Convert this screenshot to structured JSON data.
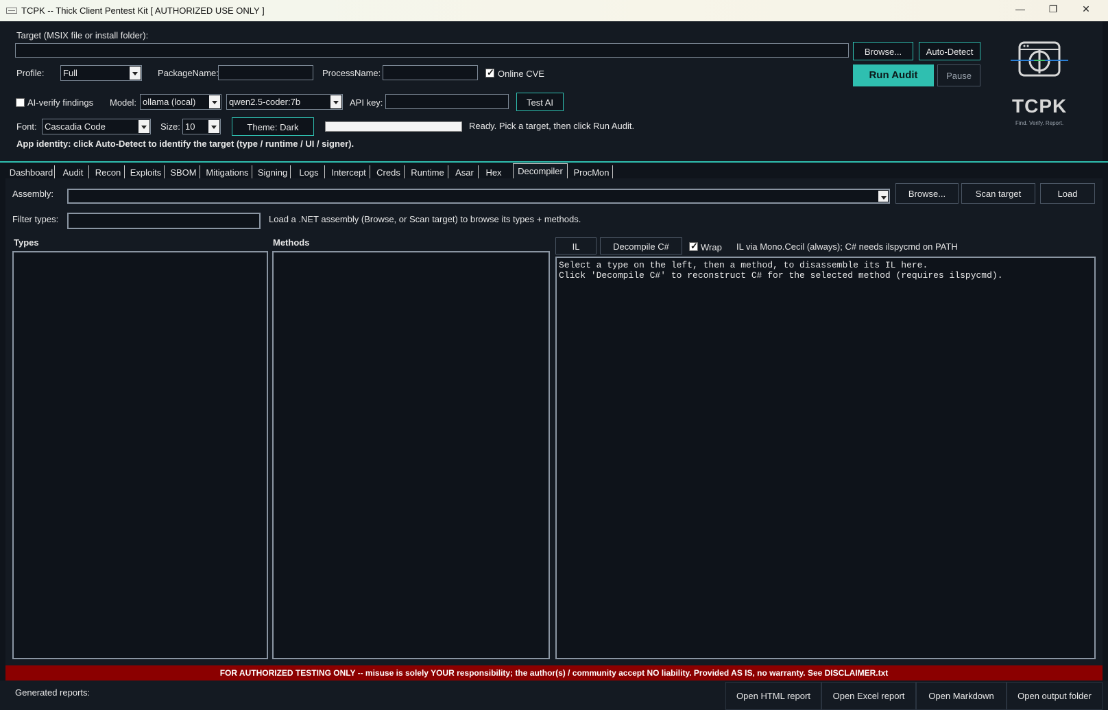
{
  "window": {
    "title": "TCPK -- Thick Client Pentest Kit   [ AUTHORIZED USE ONLY ]",
    "minimize": "—",
    "maximize": "❐",
    "close": "✕"
  },
  "top": {
    "target_label": "Target (MSIX file or install folder):",
    "target_value": "",
    "browse": "Browse...",
    "auto_detect": "Auto-Detect",
    "profile_label": "Profile:",
    "profile_value": "Full",
    "package_label": "PackageName:",
    "package_value": "",
    "process_label": "ProcessName:",
    "process_value": "",
    "online_cve_label": "Online CVE",
    "online_cve_checked": true,
    "run_audit": "Run Audit",
    "pause": "Pause",
    "ai_verify_label": "AI-verify findings",
    "ai_verify_checked": false,
    "model_label": "Model:",
    "model_value": "ollama (local)",
    "model_name_value": "qwen2.5-coder:7b",
    "api_key_label": "API key:",
    "api_key_value": "",
    "test_ai": "Test AI",
    "font_label": "Font:",
    "font_value": "Cascadia Code",
    "size_label": "Size:",
    "size_value": "10",
    "theme_button": "Theme: Dark",
    "status": "Ready. Pick a target, then click Run Audit.",
    "progress": 0,
    "identity": "App identity: click Auto-Detect to identify the target (type / runtime / UI / signer)."
  },
  "logo": {
    "name": "TCPK",
    "tagline": "Find. Verify. Report."
  },
  "tabs": [
    {
      "label": "Dashboard"
    },
    {
      "label": "Audit"
    },
    {
      "label": "Recon"
    },
    {
      "label": "Exploits"
    },
    {
      "label": "SBOM"
    },
    {
      "label": "Mitigations"
    },
    {
      "label": "Signing"
    },
    {
      "label": "Logs"
    },
    {
      "label": "Intercept"
    },
    {
      "label": "Creds"
    },
    {
      "label": "Runtime"
    },
    {
      "label": "Asar"
    },
    {
      "label": "Hex"
    },
    {
      "label": "Decompiler"
    },
    {
      "label": "ProcMon"
    }
  ],
  "active_tab": "Decompiler",
  "decompiler": {
    "assembly_label": "Assembly:",
    "assembly_value": "",
    "browse": "Browse...",
    "scan_target": "Scan target",
    "load": "Load",
    "filter_label": "Filter types:",
    "filter_value": "",
    "hint": "Load a .NET assembly (Browse, or Scan target) to browse its types + methods.",
    "types_header": "Types",
    "methods_header": "Methods",
    "il_button": "IL",
    "decompile_button": "Decompile C#",
    "wrap_label": "Wrap",
    "wrap_checked": true,
    "il_note": "IL via Mono.Cecil (always); C# needs ilspycmd on PATH",
    "output_line1": "Select a type on the left, then a method, to disassemble its IL here.",
    "output_line2": "Click 'Decompile C#' to reconstruct C# for the selected method (requires ilspycmd)."
  },
  "banner": "FOR AUTHORIZED TESTING ONLY  --  misuse is solely YOUR responsibility; the author(s) / community accept NO liability.  Provided AS IS, no warranty.  See DISCLAIMER.txt",
  "bottom": {
    "generated_label": "Generated reports:",
    "open_html": "Open HTML report",
    "open_excel": "Open Excel report",
    "open_markdown": "Open Markdown",
    "open_folder": "Open output folder"
  },
  "colors": {
    "accent": "#2fbfb0",
    "banner": "#8b0000",
    "background": "#141a22"
  }
}
